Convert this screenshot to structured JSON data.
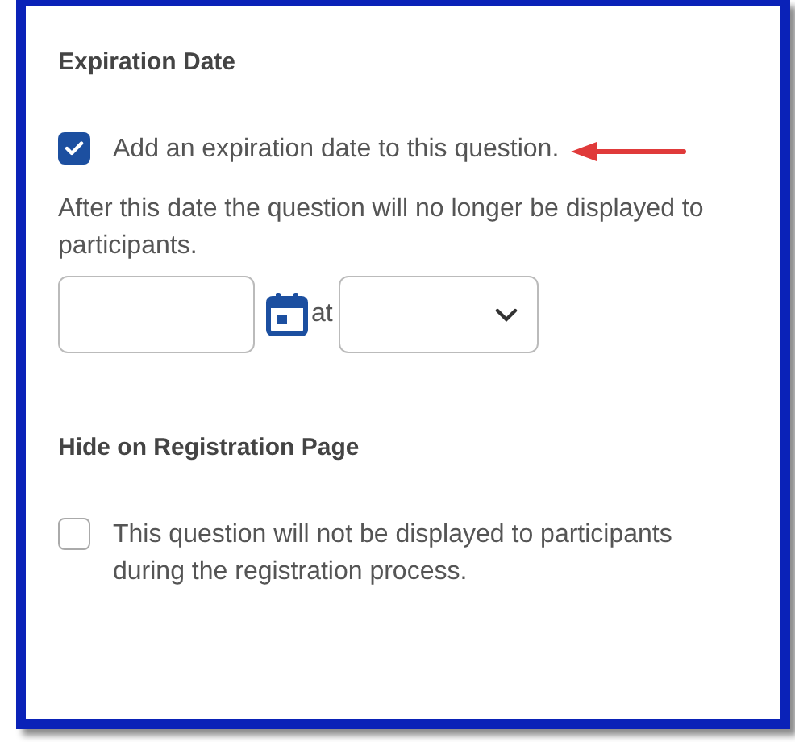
{
  "sections": [
    {
      "heading": "Expiration Date",
      "checkbox": {
        "label": "Add an expiration date to this question.",
        "checked": true
      },
      "note": "After this date the question will no longer be displayed to participants.",
      "date_row": {
        "joiner": "at"
      }
    },
    {
      "heading": "Hide on Registration Page",
      "checkbox": {
        "label": "This question will not be displayed to participants during the registration process.",
        "checked": false
      }
    }
  ]
}
